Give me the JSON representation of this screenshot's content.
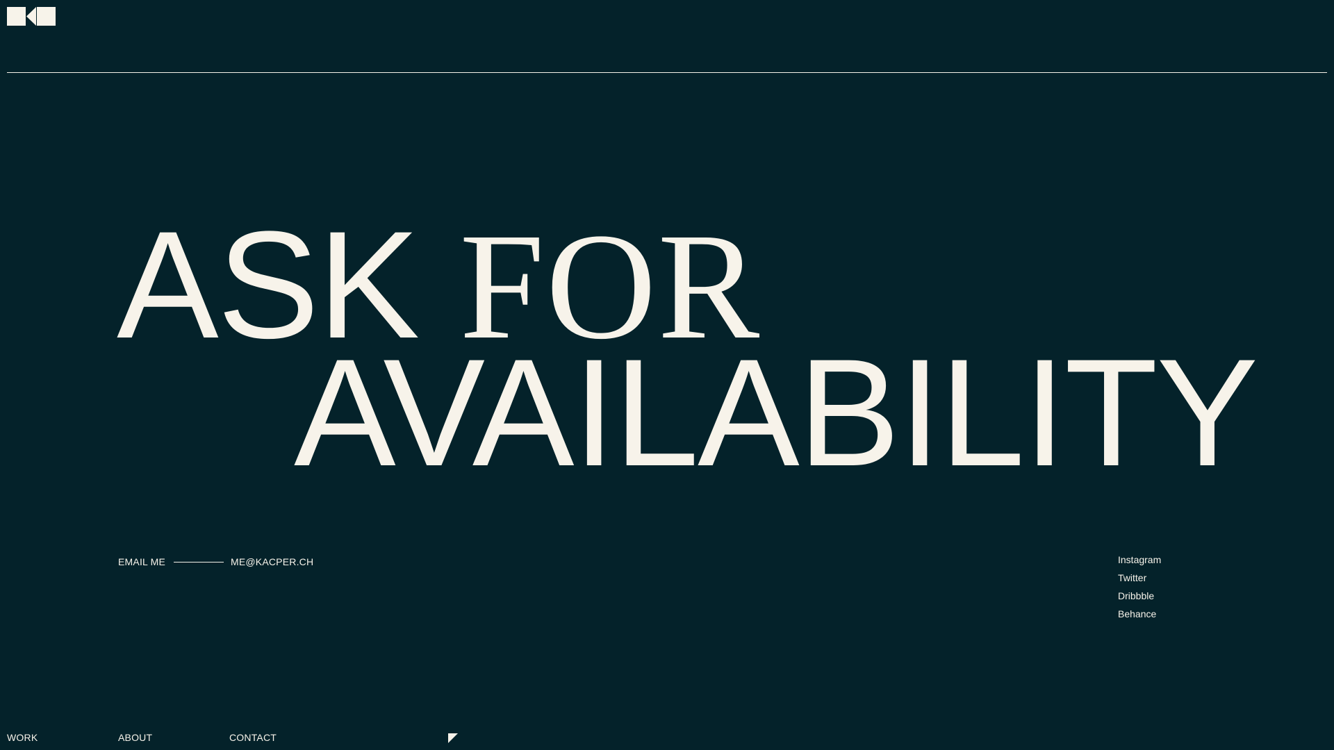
{
  "logo": {
    "icon": "kc-monogram-icon",
    "color": "#f7f3ea"
  },
  "headline": {
    "line1_word1": "ASK",
    "line1_word2": "FOR",
    "line2": "AVAILABILITY"
  },
  "contact": {
    "label": "EMAIL ME",
    "email": "ME@KACPER.CH"
  },
  "social": {
    "items": [
      {
        "label": "Instagram"
      },
      {
        "label": "Twitter"
      },
      {
        "label": "Dribbble"
      },
      {
        "label": "Behance"
      }
    ]
  },
  "nav": {
    "work": "WORK",
    "about": "ABOUT",
    "contact": "CONTACT",
    "arrow_icon": "arrow-up-left-icon"
  },
  "colors": {
    "background": "#04222a",
    "foreground": "#f7f3ea"
  }
}
